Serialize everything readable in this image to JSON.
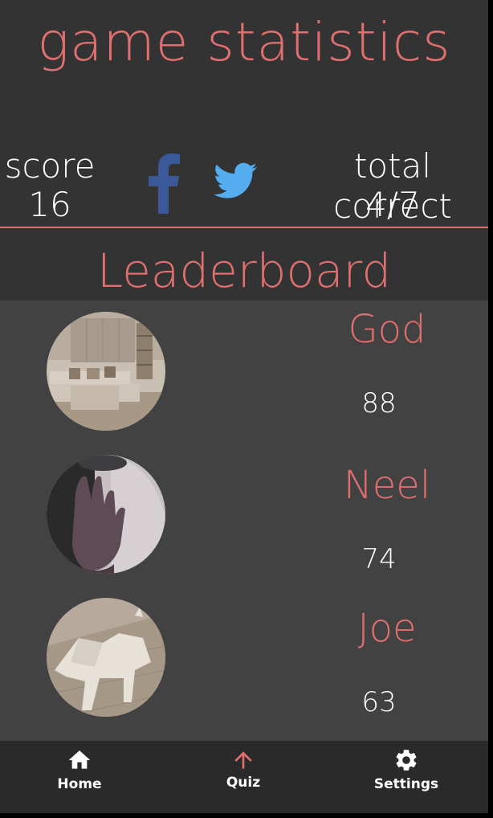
{
  "header": {
    "title": "game statistics"
  },
  "stats": {
    "score_label": "score",
    "score_value": "16",
    "correct_label": "total correct",
    "correct_value": "4/7"
  },
  "social": {
    "facebook_icon": "facebook-icon",
    "twitter_icon": "twitter-icon",
    "facebook_color": "#3b5998",
    "twitter_color": "#55acee"
  },
  "leaderboard": {
    "title": "Leaderboard",
    "entries": [
      {
        "name": "God",
        "score": "88",
        "avatar": "living-room-photo"
      },
      {
        "name": "Neel",
        "score": "74",
        "avatar": "hand-photo"
      },
      {
        "name": "Joe",
        "score": "63",
        "avatar": "dog-model-photo"
      }
    ]
  },
  "nav": {
    "items": [
      {
        "label": "Home",
        "icon": "home-icon",
        "active": false
      },
      {
        "label": "Quiz",
        "icon": "arrow-up-icon",
        "active": true
      },
      {
        "label": "Settings",
        "icon": "gear-icon",
        "active": false
      }
    ]
  },
  "colors": {
    "accent": "#e07070",
    "background": "#333333",
    "list_background": "#424242",
    "nav_background": "#2a2a2a",
    "text": "#ffffff"
  }
}
